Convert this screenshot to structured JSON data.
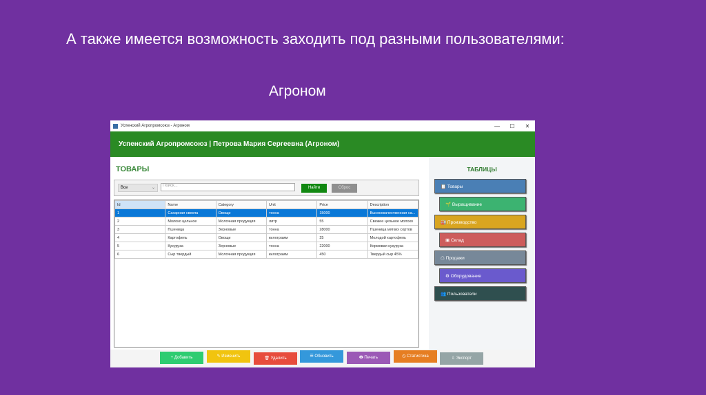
{
  "slide": {
    "title": "А также имеется возможность заходить под разными пользователями:",
    "subtitle": "Агроном"
  },
  "window": {
    "title": "Успенский Агропромсоюз - Агроном",
    "controls": [
      "—",
      "☐",
      "✕"
    ]
  },
  "header": "Успенский Агропромсоюз | Петрова Мария Сергеевна (Агроном)",
  "left": {
    "title": "ТОВАРЫ",
    "filter": {
      "category": "Все",
      "search_placeholder": "Поиск...",
      "find": "Найти",
      "reset": "Сброс"
    }
  },
  "table": {
    "columns": [
      "Id",
      "Name",
      "Category",
      "Unit",
      "Price",
      "Description"
    ],
    "rows": [
      [
        "1",
        "Сахарная свекла",
        "Овощи",
        "тонна",
        "15000",
        "Высококачественная са..."
      ],
      [
        "2",
        "Молоко цельное",
        "Молочная продукция",
        "литр",
        "55",
        "Свежее цельное молоко"
      ],
      [
        "3",
        "Пшеница",
        "Зерновые",
        "тонна",
        "28000",
        "Пшеница мягких сортов"
      ],
      [
        "4",
        "Картофель",
        "Овощи",
        "килограмм",
        "25",
        "Молодой картофель"
      ],
      [
        "5",
        "Кукуруза",
        "Зерновые",
        "тонна",
        "22000",
        "Кормовая кукуруза"
      ],
      [
        "6",
        "Сыр твердый",
        "Молочная продукция",
        "килограмм",
        "450",
        "Твердый сыр 45%"
      ]
    ]
  },
  "right": {
    "title": "ТАБЛИЦЫ",
    "buttons": [
      {
        "label": "Товары",
        "icon": "📋",
        "color": "#4a7fb5"
      },
      {
        "label": "Выращивание",
        "icon": "🌱",
        "color": "#3cb371"
      },
      {
        "label": "Производство",
        "icon": "🏭",
        "color": "#d9a520"
      },
      {
        "label": "Склад",
        "icon": "▣",
        "color": "#cd5c5c"
      },
      {
        "label": "Продажи",
        "icon": "☖",
        "color": "#778899"
      },
      {
        "label": "Оборудование",
        "icon": "⚙",
        "color": "#6a5acd"
      },
      {
        "label": "Пользователи",
        "icon": "👥",
        "color": "#2f4f4f"
      }
    ]
  },
  "bottom": [
    {
      "label": "+ Добавить",
      "color": "#2ecc71"
    },
    {
      "label": "✎ Изменить",
      "color": "#f1c40f"
    },
    {
      "label": "🗑 Удалить",
      "color": "#e74c3c"
    },
    {
      "label": "☰ Обновить",
      "color": "#3498db"
    },
    {
      "label": "🖶 Печать",
      "color": "#9b59b6"
    },
    {
      "label": "◷ Статистика",
      "color": "#e67e22"
    },
    {
      "label": "⇩ Экспорт",
      "color": "#95a5a6"
    }
  ]
}
